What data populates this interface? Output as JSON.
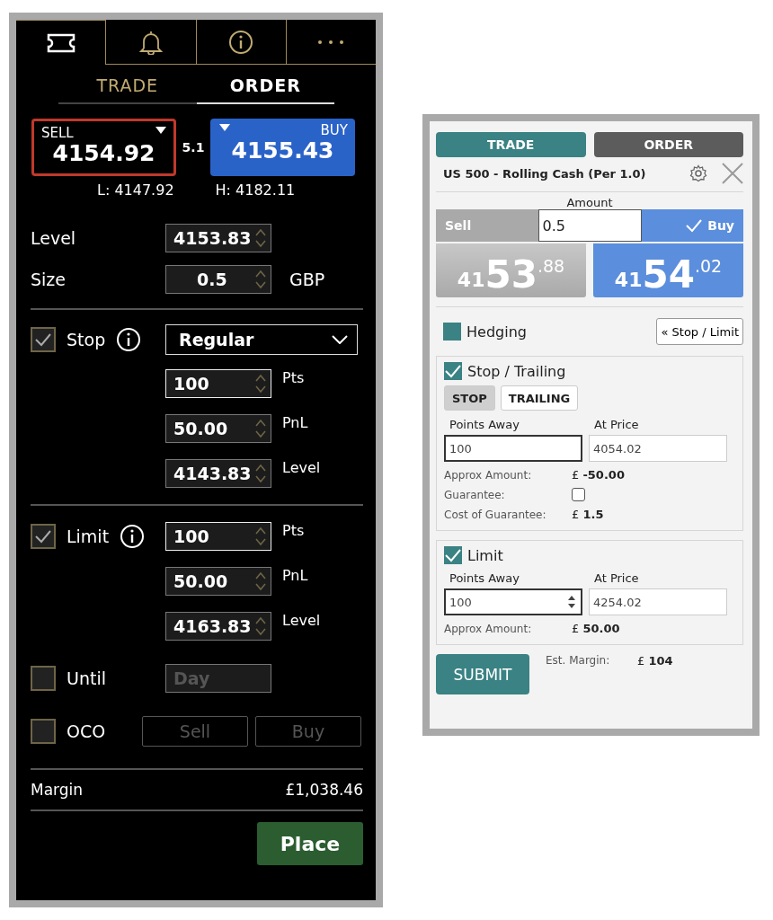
{
  "left_panel": {
    "icon_tabs": [
      {
        "kind": "ticket",
        "selected": true
      },
      {
        "kind": "bell",
        "selected": false
      },
      {
        "kind": "info",
        "selected": false
      },
      {
        "kind": "more",
        "selected": false
      }
    ],
    "mode_tabs": [
      {
        "label": "TRADE",
        "selected": false
      },
      {
        "label": "ORDER",
        "selected": true
      }
    ],
    "sell": {
      "label": "SELL",
      "price": "4154.92"
    },
    "spread": "5.1",
    "buy": {
      "label": "BUY",
      "price": "4155.43"
    },
    "low": "L: 4147.92",
    "high": "H: 4182.11",
    "level": {
      "label": "Level",
      "value": "4153.83"
    },
    "size": {
      "label": "Size",
      "value": "0.5",
      "unit": "GBP"
    },
    "stop": {
      "label": "Stop",
      "checked": true,
      "type": "Regular",
      "fields": [
        {
          "value": "100",
          "unit": "Pts",
          "focused": true
        },
        {
          "value": "50.00",
          "unit": "PnL",
          "focused": false
        },
        {
          "value": "4143.83",
          "unit": "Level",
          "focused": false
        }
      ]
    },
    "limit": {
      "label": "Limit",
      "checked": true,
      "fields": [
        {
          "value": "100",
          "unit": "Pts",
          "focused": true
        },
        {
          "value": "50.00",
          "unit": "PnL",
          "focused": false
        },
        {
          "value": "4163.83",
          "unit": "Level",
          "focused": false
        }
      ]
    },
    "until": {
      "label": "Until",
      "checked": false,
      "value": "Day",
      "disabled": true
    },
    "oco": {
      "label": "OCO",
      "checked": false,
      "buttons": [
        "Sell",
        "Buy"
      ]
    },
    "margin": {
      "label": "Margin",
      "value": "£1,038.46"
    },
    "place_button": "Place"
  },
  "right_panel": {
    "tabs": [
      {
        "label": "TRADE",
        "selected": true
      },
      {
        "label": "ORDER",
        "selected": false
      }
    ],
    "title": "US 500 - Rolling Cash (Per 1.0)",
    "amount_label": "Amount",
    "amount_value": "0.5",
    "sell": {
      "label": "Sell",
      "selected": false,
      "price": {
        "prefix": "41",
        "main": "53",
        "suffix": ".88"
      }
    },
    "buy": {
      "label": "Buy",
      "selected": true,
      "price": {
        "prefix": "41",
        "main": "54",
        "suffix": ".02"
      }
    },
    "hedging": {
      "label": "Hedging",
      "checked": true
    },
    "stop_limit_button": "« Stop / Limit",
    "stop_section": {
      "label": "Stop / Trailing",
      "checked": true,
      "modes": [
        {
          "label": "STOP",
          "selected": true
        },
        {
          "label": "TRAILING",
          "selected": false
        }
      ],
      "points_label": "Points Away",
      "price_label": "At Price",
      "points": "100",
      "price": "4054.02",
      "spinner": false,
      "rows": [
        {
          "kind": "text",
          "label": "Approx Amount:",
          "value": "£ **-50.00**"
        },
        {
          "kind": "checkbox",
          "label": "Guarantee:",
          "checked": false
        },
        {
          "kind": "text",
          "label": "Cost of Guarantee:",
          "value": "£ **1.5**"
        }
      ]
    },
    "limit_section": {
      "label": "Limit",
      "checked": true,
      "points_label": "Points Away",
      "price_label": "At Price",
      "points": "100",
      "price": "4254.02",
      "spinner": true,
      "rows": [
        {
          "kind": "text",
          "label": "Approx Amount:",
          "value": "£ **50.00**"
        }
      ]
    },
    "submit_button": "SUBMIT",
    "margin_label": "Est. Margin:",
    "margin_value": "£ **104**"
  }
}
